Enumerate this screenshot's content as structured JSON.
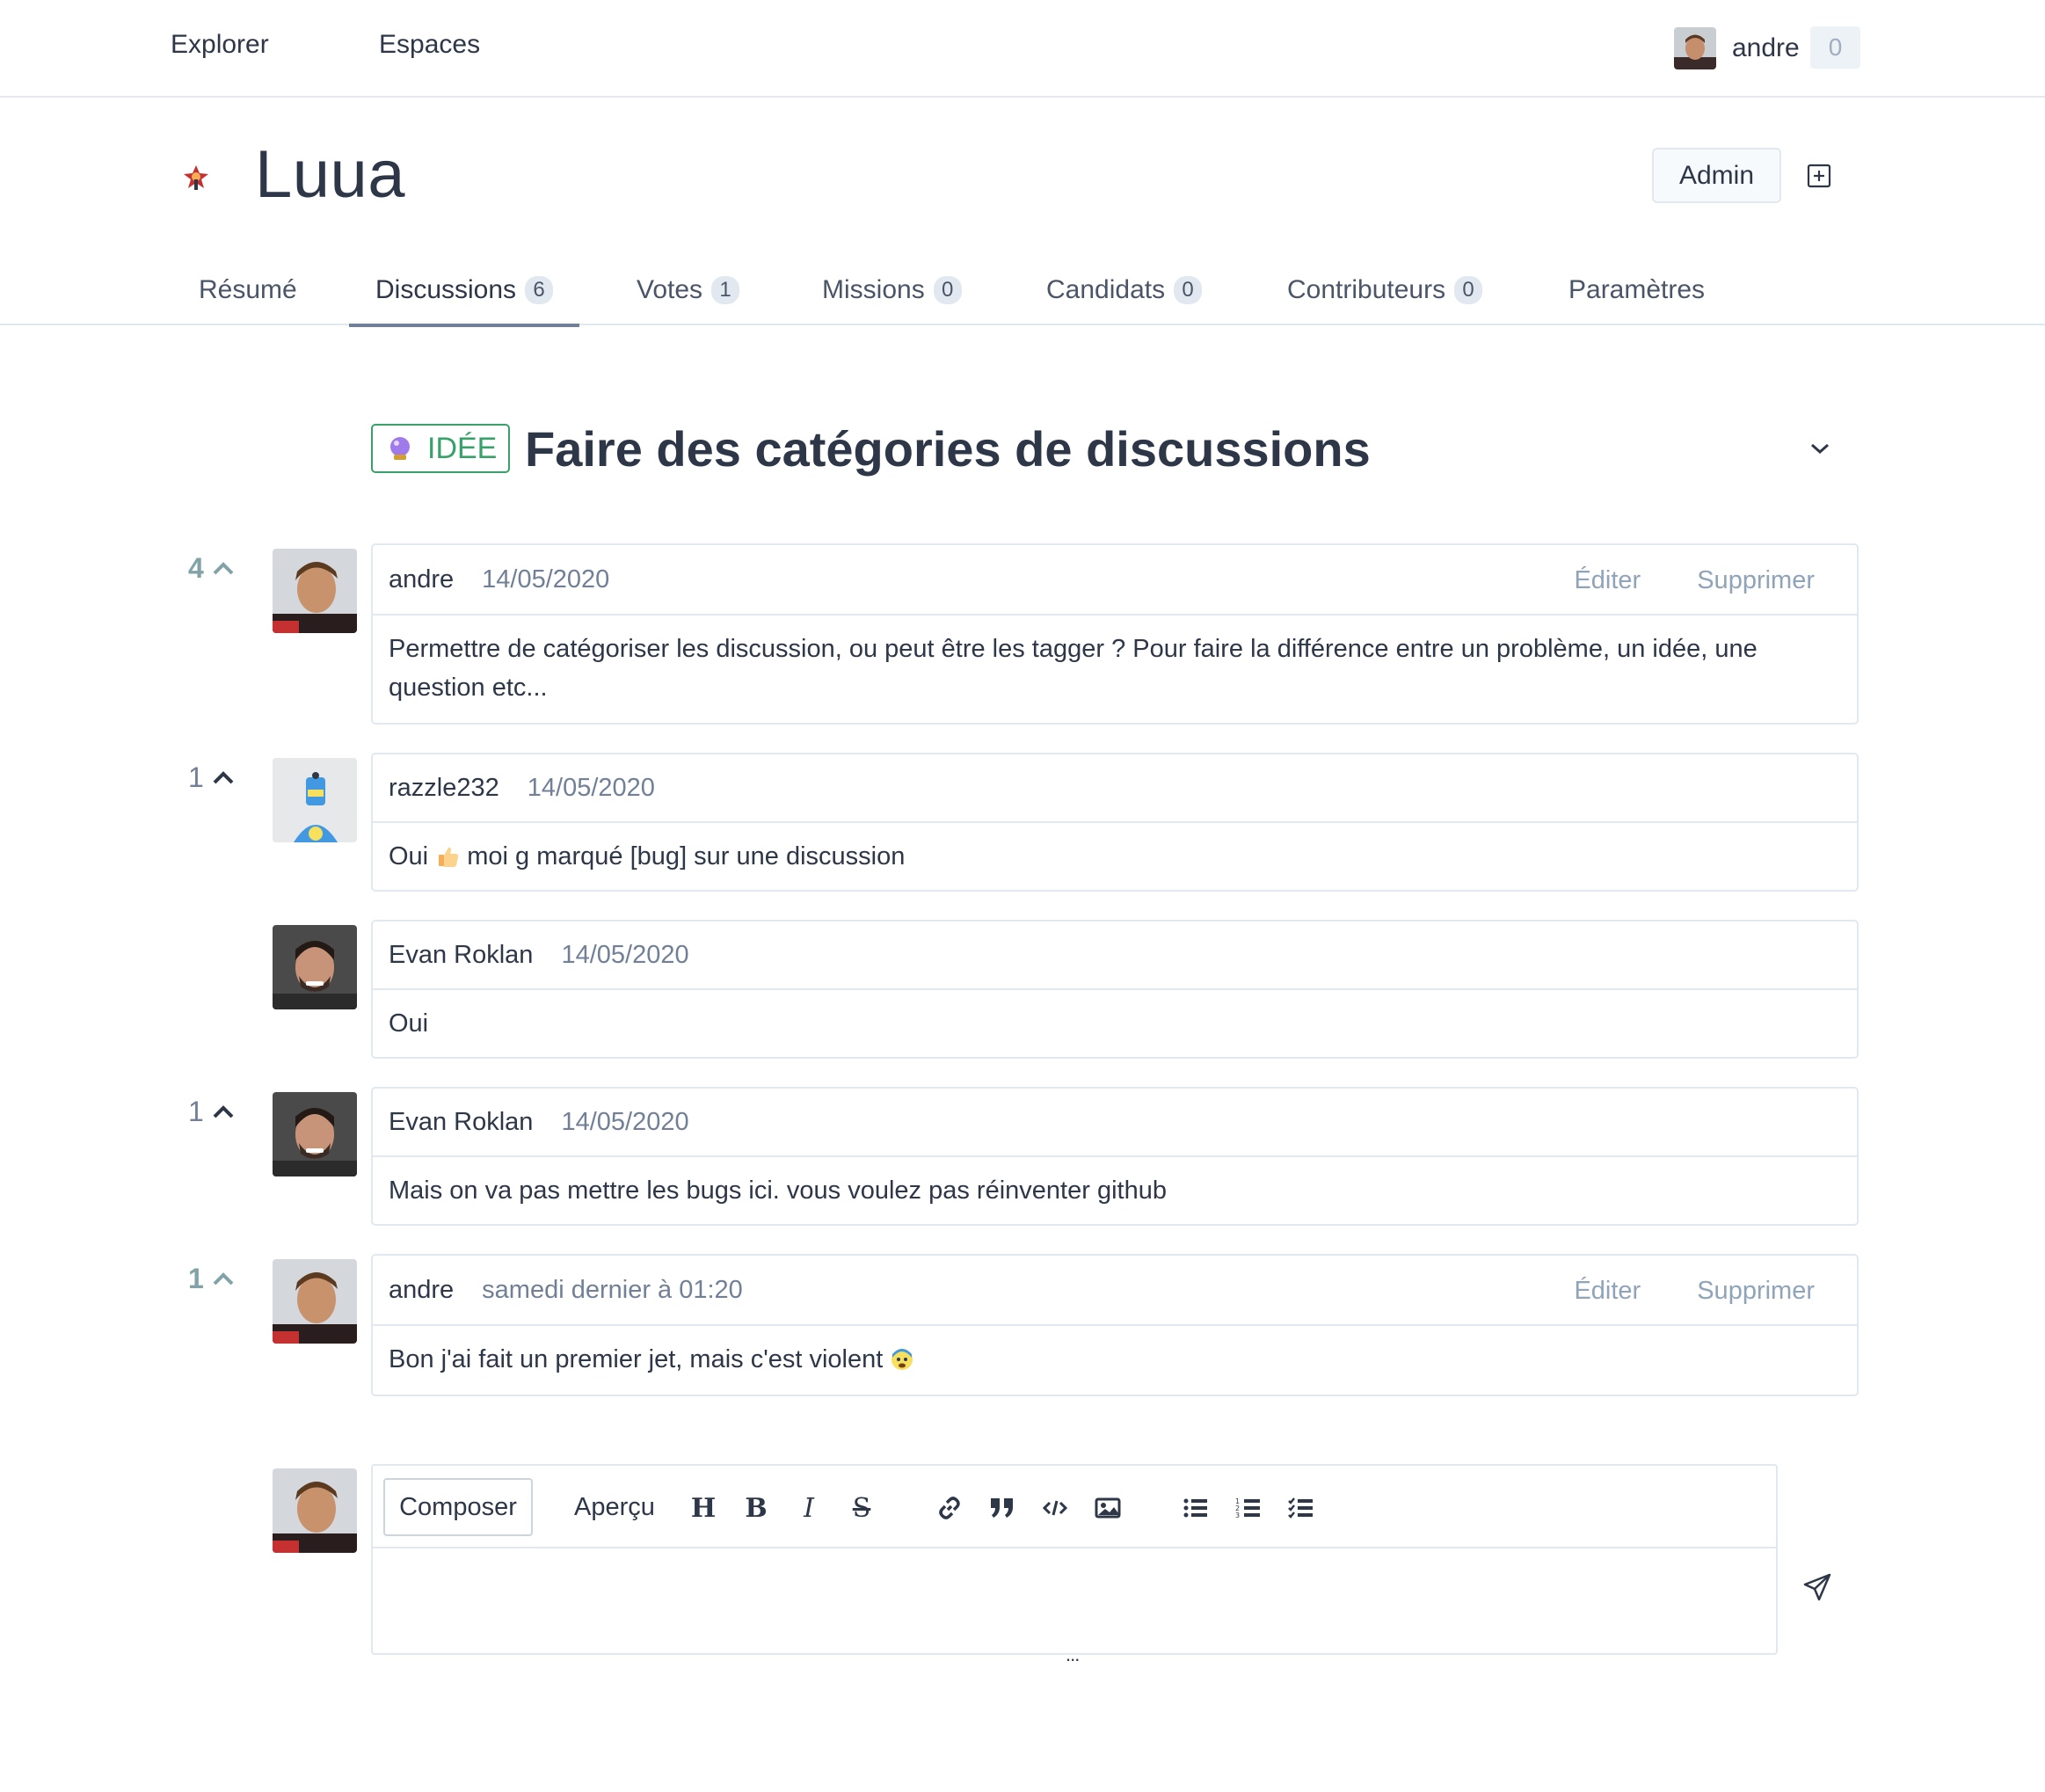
{
  "topnav": {
    "links": [
      "Explorer",
      "Espaces"
    ],
    "user_name": "andre",
    "notifications": "0"
  },
  "space": {
    "title": "Luua",
    "admin_label": "Admin"
  },
  "tabs": [
    {
      "label": "Résumé",
      "count": null
    },
    {
      "label": "Discussions",
      "count": "6",
      "active": true
    },
    {
      "label": "Votes",
      "count": "1"
    },
    {
      "label": "Missions",
      "count": "0"
    },
    {
      "label": "Candidats",
      "count": "0"
    },
    {
      "label": "Contributeurs",
      "count": "0"
    },
    {
      "label": "Paramètres",
      "count": null
    }
  ],
  "discussion": {
    "tag": "IDÉE",
    "title": "Faire des catégories de discussions"
  },
  "comments": [
    {
      "votes": "4",
      "voted": true,
      "author": "andre",
      "date": "14/05/2020",
      "edit": "Éditer",
      "delete": "Supprimer",
      "text": "Permettre de catégoriser les discussion, ou peut être les tagger ? Pour faire la différence entre un problème, un idée, une question etc..."
    },
    {
      "votes": "1",
      "voted": false,
      "author": "razzle232",
      "date": "14/05/2020",
      "text_before": "Oui",
      "text_after": "moi g marqué [bug] sur une discussion"
    },
    {
      "votes": "",
      "author": "Evan Roklan",
      "date": "14/05/2020",
      "text": "Oui"
    },
    {
      "votes": "1",
      "voted": false,
      "author": "Evan Roklan",
      "date": "14/05/2020",
      "text": "Mais on va pas mettre les bugs ici. vous voulez pas réinventer github"
    },
    {
      "votes": "1",
      "voted": true,
      "author": "andre",
      "date": "samedi dernier à 01:20",
      "edit": "Éditer",
      "delete": "Supprimer",
      "text": "Bon j'ai fait un premier jet, mais c'est violent"
    }
  ],
  "composer": {
    "compose_label": "Composer",
    "preview_label": "Aperçu",
    "tools": [
      "heading-icon",
      "bold-icon",
      "italic-icon",
      "strikethrough-icon",
      "link-icon",
      "quote-icon",
      "code-icon",
      "image-icon",
      "bullet-list-icon",
      "numbered-list-icon",
      "checklist-icon"
    ],
    "resize_handle": "..."
  },
  "colors": {
    "accent_green": "#38a169",
    "voted": "#81a3a8",
    "border": "#e2e8f0",
    "muted_link": "#8fa4b8"
  }
}
